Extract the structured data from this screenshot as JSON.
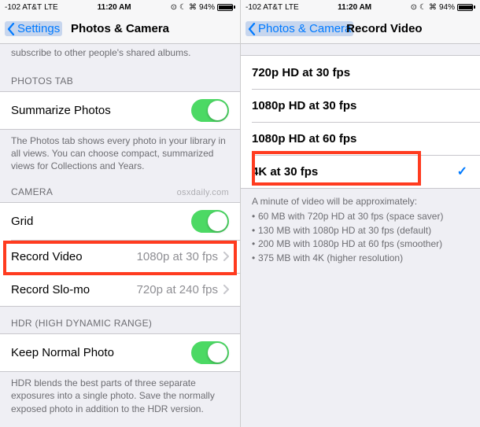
{
  "status": {
    "carrier_signal": "-102 AT&T",
    "network": "LTE",
    "time": "11:20 AM",
    "alarm_icon": "alarm",
    "dnd_icon": "do-not-disturb",
    "bt_icon": "bluetooth",
    "battery_pct": "94%"
  },
  "left": {
    "nav_back": "Settings",
    "nav_title": "Photos & Camera",
    "truncated_top": "subscribe to other people's shared albums.",
    "photos_tab_header": "PHOTOS TAB",
    "summarize_label": "Summarize Photos",
    "summarize_footer": "The Photos tab shows every photo in your library in all views. You can choose compact, summarized views for Collections and Years.",
    "camera_header": "CAMERA",
    "watermark": "osxdaily.com",
    "grid_label": "Grid",
    "record_video_label": "Record Video",
    "record_video_value": "1080p at 30 fps",
    "record_slomo_label": "Record Slo-mo",
    "record_slomo_value": "720p at 240 fps",
    "hdr_header": "HDR (HIGH DYNAMIC RANGE)",
    "keep_normal_label": "Keep Normal Photo",
    "hdr_footer": "HDR blends the best parts of three separate exposures into a single photo. Save the normally exposed photo in addition to the HDR version."
  },
  "right": {
    "nav_back": "Photos & Camera",
    "nav_title": "Record Video",
    "options": [
      {
        "label": "720p HD at 30 fps",
        "selected": false
      },
      {
        "label": "1080p HD at 30 fps",
        "selected": false
      },
      {
        "label": "1080p HD at 60 fps",
        "selected": false
      },
      {
        "label": "4K at 30 fps",
        "selected": true
      }
    ],
    "footer_header": "A minute of video will be approximately:",
    "footer_items": [
      "60 MB with 720p HD at 30 fps (space saver)",
      "130 MB with 1080p HD at 30 fps (default)",
      "200 MB with 1080p HD at 60 fps (smoother)",
      "375 MB with 4K (higher resolution)"
    ]
  },
  "colors": {
    "accent": "#007aff",
    "toggle_on": "#4cd964",
    "highlight": "#ff3b1f"
  }
}
